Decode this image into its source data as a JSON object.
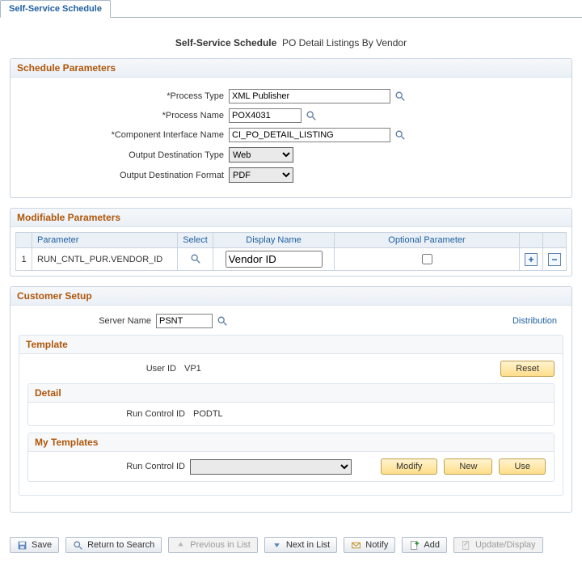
{
  "tab": {
    "label": "Self-Service Schedule"
  },
  "headline": {
    "label": "Self-Service Schedule",
    "value": "PO Detail Listings By Vendor"
  },
  "schedule": {
    "title": "Schedule Parameters",
    "process_type": {
      "label": "*Process Type",
      "value": "XML Publisher"
    },
    "process_name": {
      "label": "*Process Name",
      "value": "POX4031"
    },
    "ci_name": {
      "label": "*Component Interface Name",
      "value": "CI_PO_DETAIL_LISTING"
    },
    "output_type": {
      "label": "Output Destination Type",
      "value": "Web"
    },
    "output_format": {
      "label": "Output Destination Format",
      "value": "PDF"
    }
  },
  "mod_params": {
    "title": "Modifiable Parameters",
    "headers": {
      "num": "",
      "parameter": "Parameter",
      "select": "Select",
      "display_name": "Display Name",
      "optional": "Optional Parameter"
    },
    "rows": [
      {
        "num": "1",
        "parameter": "RUN_CNTL_PUR.VENDOR_ID",
        "display_name": "Vendor ID",
        "optional": false
      }
    ]
  },
  "customer": {
    "title": "Customer Setup",
    "server_name": {
      "label": "Server Name",
      "value": "PSNT"
    },
    "distribution_link": "Distribution"
  },
  "template": {
    "title": "Template",
    "user_id": {
      "label": "User ID",
      "value": "VP1"
    },
    "reset": "Reset",
    "detail": {
      "title": "Detail",
      "run_control_id": {
        "label": "Run Control ID",
        "value": "PODTL"
      }
    },
    "my_templates": {
      "title": "My Templates",
      "run_control_id": {
        "label": "Run Control ID",
        "value": ""
      },
      "buttons": {
        "modify": "Modify",
        "new": "New",
        "use": "Use"
      }
    }
  },
  "toolbar": {
    "save": "Save",
    "return": "Return to Search",
    "prev": "Previous in List",
    "next": "Next in List",
    "notify": "Notify",
    "add": "Add",
    "update": "Update/Display"
  }
}
